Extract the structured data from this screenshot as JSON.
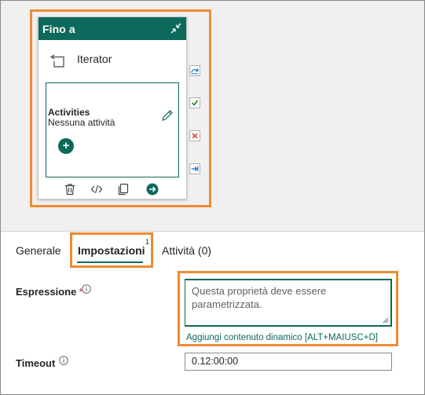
{
  "canvas": {
    "card": {
      "title": "Fino a",
      "type_label": "Iterator",
      "activities_title": "Activities",
      "activities_empty": "Nessuna attività",
      "add_label": "+"
    },
    "side_icons": [
      "skip-icon",
      "success-icon",
      "failure-icon",
      "completion-icon"
    ],
    "footer_icons": [
      "delete-icon",
      "code-icon",
      "copy-icon",
      "go-icon"
    ]
  },
  "tabs": [
    {
      "label": "Generale",
      "active": false
    },
    {
      "label": "Impostazioni",
      "active": true,
      "badge": "1"
    },
    {
      "label": "Attività (0)",
      "active": false
    }
  ],
  "form": {
    "expression": {
      "label": "Espressione",
      "required_mark": "*",
      "placeholder": "Questa proprietà deve essere parametrizzata.",
      "dynamic_link": "Aggiungi contenuto dinamico [ALT+MAIUSC+D]"
    },
    "timeout": {
      "label": "Timeout",
      "value": "0.12:00:00"
    }
  },
  "colors": {
    "accent": "#0c695b",
    "highlight": "#ef8b33",
    "required": "#c4314b",
    "failure": "#d13438",
    "link_blue": "#0f6cbd"
  }
}
